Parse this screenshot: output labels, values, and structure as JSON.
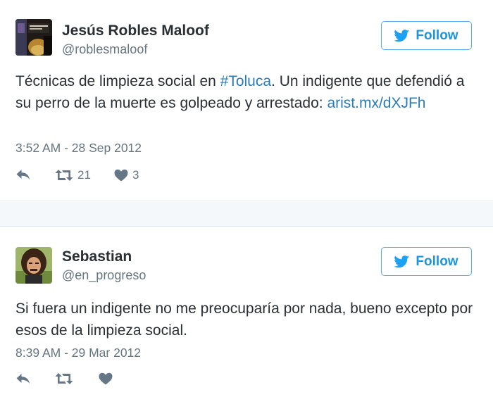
{
  "tweets": [
    {
      "name": "Jesús Robles Maloof",
      "handle": "@roblesmaloof",
      "follow_label": "Follow",
      "text_before": "Técnicas de limpieza social en ",
      "hashtag": "#Toluca",
      "text_after": ". Un indigente que defendió a su perro de la muerte es golpeado y arrestado: ",
      "link": "arist.mx/dXJFh",
      "timestamp": "3:52 AM - 28 Sep 2012",
      "retweets": "21",
      "likes": "3"
    },
    {
      "name": "Sebastian",
      "handle": "@en_progreso",
      "follow_label": "Follow",
      "text": "Si fuera un indigente no me preocuparía por nada, bueno excepto por esos de la limpieza social.",
      "timestamp": "8:39 AM - 29 Mar 2012"
    }
  ],
  "colors": {
    "accent": "#1b95e0",
    "link": "#2b7bb9",
    "text": "#292f33",
    "muted": "#66757f",
    "border": "#e1e8ed"
  },
  "icons": [
    "twitter-bird-icon",
    "reply-icon",
    "retweet-icon",
    "heart-icon"
  ]
}
